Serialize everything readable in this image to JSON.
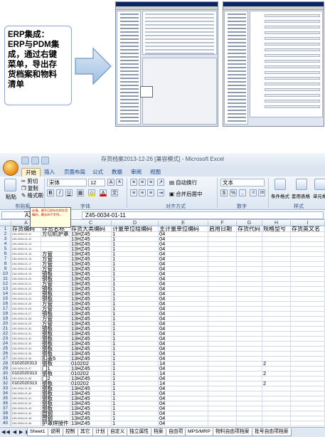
{
  "callout": {
    "lines": [
      "ERP集成：",
      "ERP与PDM集",
      "成，通过右键",
      "菜单，导出存",
      "货档案和物料",
      "清单"
    ]
  },
  "excel": {
    "title": "存货档案2013-12-26 [兼容模式] - Microsoft Excel",
    "tabs": [
      "开始",
      "插入",
      "页面布局",
      "公式",
      "数据",
      "审阅",
      "视图"
    ],
    "ribbon": {
      "clipboard": {
        "paste": "粘贴",
        "cut": "剪切",
        "copy": "复制",
        "format_painter": "格式刷",
        "label": "剪贴板"
      },
      "font": {
        "name": "宋体",
        "size": "12",
        "label": "字体",
        "bold": "B",
        "italic": "I",
        "underline": "U",
        "grow": "A",
        "shrink": "A"
      },
      "alignment": {
        "wrap": "自动换行",
        "merge": "合并后居中",
        "label": "对齐方式"
      },
      "number": {
        "format": "文本",
        "label": "数字"
      },
      "styles": {
        "conditional": "条件格式",
        "table": "套用表格格式",
        "cell": "单元格样式",
        "label": "样式"
      }
    },
    "formula_bar": {
      "name_box": "A2",
      "fx": "fx",
      "formula": "Z45-0034-01-11"
    },
    "columns": [
      "A",
      "B",
      "C",
      "D",
      "E",
      "F",
      "G",
      "H",
      "I"
    ],
    "header_row": [
      "存货编码",
      "存货名称",
      "存货大类编码",
      "计量单位组编码",
      "主计量单位编码",
      "启用日期",
      "存货代码",
      "规格型号",
      "存货英文名"
    ],
    "comment": "必填，填写已经存在的存货编码，最长20个字符。",
    "rows": [
      {
        "n": "2",
        "a": "Z45-0034-01-11",
        "b": "方切机护罩",
        "c": "13HZ45",
        "d": "1",
        "e": "04",
        "h": ""
      },
      {
        "n": "3",
        "a": "Z45-0034-01-12",
        "b": "",
        "c": "13HZ45",
        "d": "1",
        "e": "04",
        "h": ""
      },
      {
        "n": "4",
        "a": "Z45-0034-01-13",
        "b": "",
        "c": "13HZ45",
        "d": "1",
        "e": "04",
        "h": ""
      },
      {
        "n": "5",
        "a": "Z45-0034-01-14",
        "b": "",
        "c": "13HZ45",
        "d": "1",
        "e": "04",
        "h": ""
      },
      {
        "n": "6",
        "a": "Z45-0034-01-15",
        "b": "方管",
        "c": "13HZ45",
        "d": "1",
        "e": "04",
        "h": ""
      },
      {
        "n": "7",
        "a": "Z45-0034-01-16",
        "b": "方管",
        "c": "13HZ45",
        "d": "1",
        "e": "04",
        "h": ""
      },
      {
        "n": "8",
        "a": "Z45-0034-01-17",
        "b": "方管",
        "c": "13HZ45",
        "d": "1",
        "e": "04",
        "h": ""
      },
      {
        "n": "9",
        "a": "Z45-0034-01-18",
        "b": "方管",
        "c": "13HZ45",
        "d": "1",
        "e": "04",
        "h": ""
      },
      {
        "n": "10",
        "a": "Z45-0034-01-19",
        "b": "钢板",
        "c": "13HZ45",
        "d": "1",
        "e": "04",
        "h": ""
      },
      {
        "n": "11",
        "a": "Z45-0034-01-20",
        "b": "钢板",
        "c": "13HZ45",
        "d": "1",
        "e": "04",
        "h": ""
      },
      {
        "n": "12",
        "a": "Z45-0034-01-21",
        "b": "方管",
        "c": "13HZ45",
        "d": "1",
        "e": "04",
        "h": ""
      },
      {
        "n": "13",
        "a": "Z45-0034-01-22",
        "b": "钢板",
        "c": "13HZ45",
        "d": "1",
        "e": "04",
        "h": ""
      },
      {
        "n": "14",
        "a": "Z45-0034-01-23",
        "b": "钢板",
        "c": "13HZ45",
        "d": "1",
        "e": "04",
        "h": ""
      },
      {
        "n": "15",
        "a": "Z45-0034-01-24",
        "b": "钢板",
        "c": "13HZ45",
        "d": "1",
        "e": "04",
        "h": ""
      },
      {
        "n": "16",
        "a": "Z45-0034-01-25",
        "b": "方管",
        "c": "13HZ45",
        "d": "1",
        "e": "04",
        "h": ""
      },
      {
        "n": "17",
        "a": "Z45-0034-01-26",
        "b": "方管",
        "c": "13HZ45",
        "d": "1",
        "e": "04",
        "h": ""
      },
      {
        "n": "18",
        "a": "Z45-0034-01-27",
        "b": "钢板",
        "c": "13HZ45",
        "d": "1",
        "e": "04",
        "h": ""
      },
      {
        "n": "19",
        "a": "Z45-0034-01-28",
        "b": "方管",
        "c": "13HZ45",
        "d": "1",
        "e": "04",
        "h": ""
      },
      {
        "n": "20",
        "a": "Z45-0034-01-29",
        "b": "方管",
        "c": "13HZ45",
        "d": "1",
        "e": "04",
        "h": ""
      },
      {
        "n": "21",
        "a": "Z45-0034-01-30",
        "b": "钢板",
        "c": "13HZ45",
        "d": "1",
        "e": "04",
        "h": ""
      },
      {
        "n": "22",
        "a": "Z45-0034-01-31",
        "b": "钢板",
        "c": "13HZ45",
        "d": "1",
        "e": "04",
        "h": ""
      },
      {
        "n": "23",
        "a": "Z45-0034-01-32",
        "b": "钢板",
        "c": "13HZ45",
        "d": "1",
        "e": "04",
        "h": ""
      },
      {
        "n": "24",
        "a": "Z45-0034-01-33",
        "b": "钢板",
        "c": "13HZ45",
        "d": "1",
        "e": "04",
        "h": ""
      },
      {
        "n": "25",
        "a": "Z45-0034-01-34",
        "b": "钢板",
        "c": "13HZ45",
        "d": "1",
        "e": "04",
        "h": ""
      },
      {
        "n": "26",
        "a": "Z45-0034-01-35",
        "b": "钢板",
        "c": "13HZ45",
        "d": "1",
        "e": "04",
        "h": ""
      },
      {
        "n": "27",
        "a": "Z45-0034-01-36",
        "b": "扣盖5",
        "c": "13HZ45",
        "d": "1",
        "e": "04",
        "h": ""
      },
      {
        "n": "28",
        "a": "0102020313",
        "b": "钢板",
        "c": "010202",
        "d": "1",
        "e": "14",
        "h": "2"
      },
      {
        "n": "29",
        "a": "Z45-0034-01-37",
        "b": "门1",
        "c": "13HZ45",
        "d": "1",
        "e": "04",
        "h": ""
      },
      {
        "n": "30",
        "a": "0102020313",
        "b": "钢板",
        "c": "010202",
        "d": "1",
        "e": "14",
        "h": "2"
      },
      {
        "n": "31",
        "a": "Z45-0034-01-38",
        "b": "门2",
        "c": "13HZ45",
        "d": "1",
        "e": "04",
        "h": ""
      },
      {
        "n": "32",
        "a": "0102020313",
        "b": "钢板",
        "c": "010202",
        "d": "1",
        "e": "14",
        "h": "2"
      },
      {
        "n": "33",
        "a": "Z45-0034-01-39",
        "b": "钢板",
        "c": "13HZ45",
        "d": "1",
        "e": "04",
        "h": ""
      },
      {
        "n": "34",
        "a": "Z45-0034-01-40",
        "b": "钢板",
        "c": "13HZ45",
        "d": "1",
        "e": "04",
        "h": ""
      },
      {
        "n": "35",
        "a": "Z45-0034-01-41",
        "b": "钢板",
        "c": "13HZ45",
        "d": "1",
        "e": "04",
        "h": ""
      },
      {
        "n": "36",
        "a": "Z45-0034-01-42",
        "b": "钢板",
        "c": "13HZ45",
        "d": "1",
        "e": "04",
        "h": ""
      },
      {
        "n": "37",
        "a": "Z45-0034-01-43",
        "b": "钢板",
        "c": "13HZ45",
        "d": "1",
        "e": "04",
        "h": ""
      },
      {
        "n": "38",
        "a": "Z45-0034-01-44",
        "b": "圆钢",
        "c": "13HZ45",
        "d": "1",
        "e": "04",
        "h": ""
      },
      {
        "n": "39",
        "a": "Z45-0034-01-45",
        "b": "圆钢",
        "c": "13HZ45",
        "d": "1",
        "e": "04",
        "h": ""
      },
      {
        "n": "40",
        "a": "Z45-0034-01-46",
        "b": "护罩焊接件",
        "c": "13HZ45",
        "d": "1",
        "e": "04",
        "h": ""
      }
    ],
    "sheet_tabs": [
      "Sheet1",
      "说明",
      "控制",
      "其它",
      "计划",
      "自定义",
      "独立属性",
      "档案",
      "自由项",
      "MPS/MRP",
      "物料自由项档案",
      "批号自由项档案"
    ],
    "sheet_nav": "◀◀ ◀ ▶ ▶▶"
  }
}
